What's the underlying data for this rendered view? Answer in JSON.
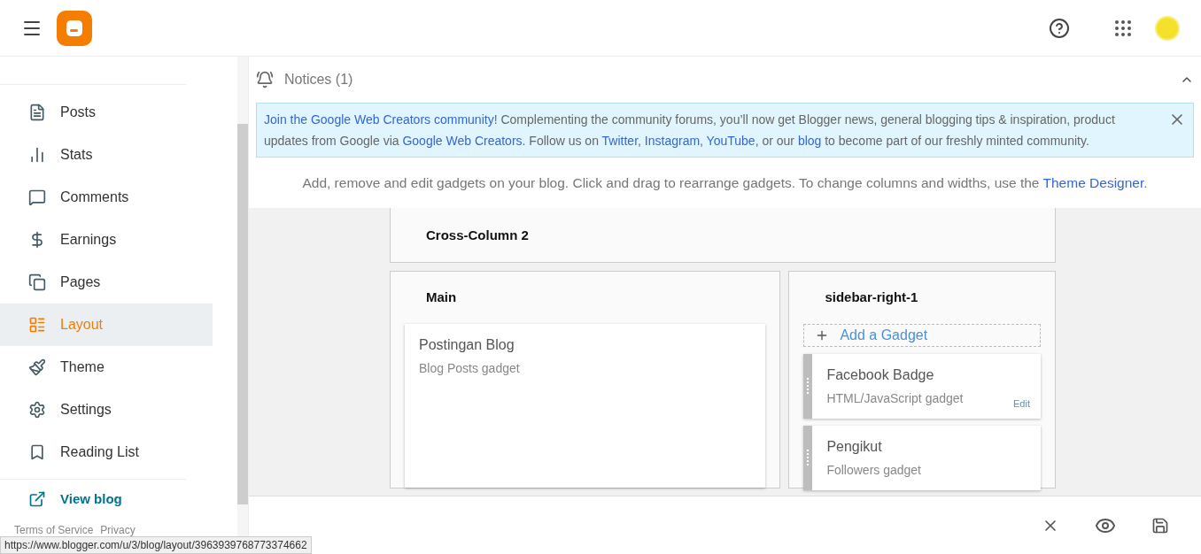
{
  "sidebar": {
    "items": [
      {
        "label": "Posts",
        "selected": false
      },
      {
        "label": "Stats",
        "selected": false
      },
      {
        "label": "Comments",
        "selected": false
      },
      {
        "label": "Earnings",
        "selected": false
      },
      {
        "label": "Pages",
        "selected": false
      },
      {
        "label": "Layout",
        "selected": true
      },
      {
        "label": "Theme",
        "selected": false
      },
      {
        "label": "Settings",
        "selected": false
      },
      {
        "label": "Reading List",
        "selected": false
      }
    ],
    "view_blog": "View blog",
    "footer_links": [
      "Terms of Service",
      "Privacy"
    ]
  },
  "status_url": "https://www.blogger.com/u/3/blog/layout/3963939768773374662",
  "notices": {
    "title": "Notices (1)",
    "expanded": true,
    "message": [
      {
        "text": "Join the Google Web Creators community",
        "link": true
      },
      {
        "text": "! Complementing the community forums, you’ll now get Blogger news, general blogging tips & inspiration, product updates from Google via ",
        "link": false
      },
      {
        "text": "Google Web Creators",
        "link": true
      },
      {
        "text": ". Follow us on ",
        "link": false
      },
      {
        "text": "Twitter",
        "link": true
      },
      {
        "text": ", ",
        "link": false
      },
      {
        "text": "Instagram",
        "link": true
      },
      {
        "text": ", ",
        "link": false
      },
      {
        "text": "YouTube",
        "link": true
      },
      {
        "text": ", or our ",
        "link": false
      },
      {
        "text": "blog",
        "link": true
      },
      {
        "text": " to become part of our freshly minted community.",
        "link": false
      }
    ]
  },
  "intro": {
    "text": "Add, remove and edit gadgets on your blog. Click and drag to rearrange gadgets. To change columns and widths, use the ",
    "link": "Theme Designer",
    "end": "."
  },
  "cross_column": {
    "title": "Cross-Column 2"
  },
  "main": {
    "title": "Main",
    "gadgets": [
      {
        "title": "Postingan Blog",
        "subtitle": "Blog Posts gadget"
      }
    ]
  },
  "sidebar_right": {
    "title": "sidebar-right-1",
    "add_gadget": "Add a Gadget",
    "gadgets": [
      {
        "title": "Facebook Badge",
        "subtitle": "HTML/JavaScript gadget",
        "edit": "Edit"
      },
      {
        "title": "Pengikut",
        "subtitle": "Followers gadget"
      }
    ]
  }
}
